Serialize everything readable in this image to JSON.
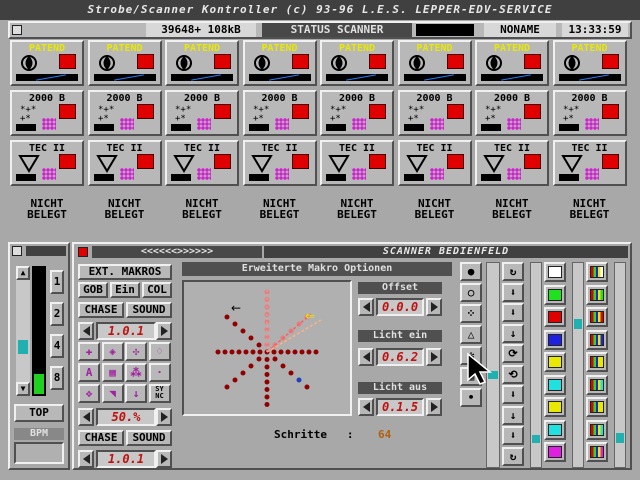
{
  "title": "Strobe/Scanner Kontroller (c) 93-96 L.E.S. LEPPER-EDV-SERVICE",
  "status": {
    "memory": "39648+ 108kB",
    "mode": "STATUS SCANNER",
    "name": "NONAME",
    "clock": "13:33:59"
  },
  "rows": [
    {
      "label": "PATEND",
      "color": "#e8e800"
    },
    {
      "label": "2000 B",
      "color": "#000000"
    },
    {
      "label": "TEC II",
      "color": "#000000"
    }
  ],
  "unassigned": {
    "line1": "NICHT",
    "line2": "BELEGT"
  },
  "left_panel": {
    "channels": [
      "1",
      "2",
      "4",
      "8"
    ],
    "top_label": "TOP",
    "bpm_label": "BPM"
  },
  "scanner": {
    "title_nav": "<<<<<<>>>>>>",
    "title": "SCANNER BEDIENFELD",
    "ext_macros": "EXT. MAKROS",
    "options_title": "Erweiterte Makro Optionen",
    "btn_gob": "GOB",
    "btn_ein": "Ein",
    "btn_col": "COL",
    "btn_chase": "CHASE",
    "btn_sound": "SOUND",
    "val1": "1.0.1",
    "percent": "50.%",
    "btn_sync": "SY NC",
    "btn_chase2": "CHASE",
    "btn_sound2": "SOUND",
    "val2": "1.0.1",
    "offset_label": "Offset",
    "offset_value": "0.0.0",
    "licht_ein_label": "Licht ein",
    "licht_ein_value": "0.6.2",
    "licht_aus_label": "Licht aus",
    "licht_aus_value": "0.1.5",
    "schritte_label": "Schritte   :",
    "schritte_value": "64"
  },
  "colors_col1": [
    "#ffffff",
    "#20e020",
    "#e00000",
    "#2020e0",
    "#e8e800",
    "#20e0e0",
    "#e8e800",
    "#20e0e0",
    "#e020e0"
  ],
  "colors_col2": [
    "#ffffff",
    "#20e020",
    "#e00000",
    "#2020e0",
    "#e8e800",
    "#20e0e0",
    "#e8e800",
    "#20e0e0",
    "#e020e0"
  ]
}
